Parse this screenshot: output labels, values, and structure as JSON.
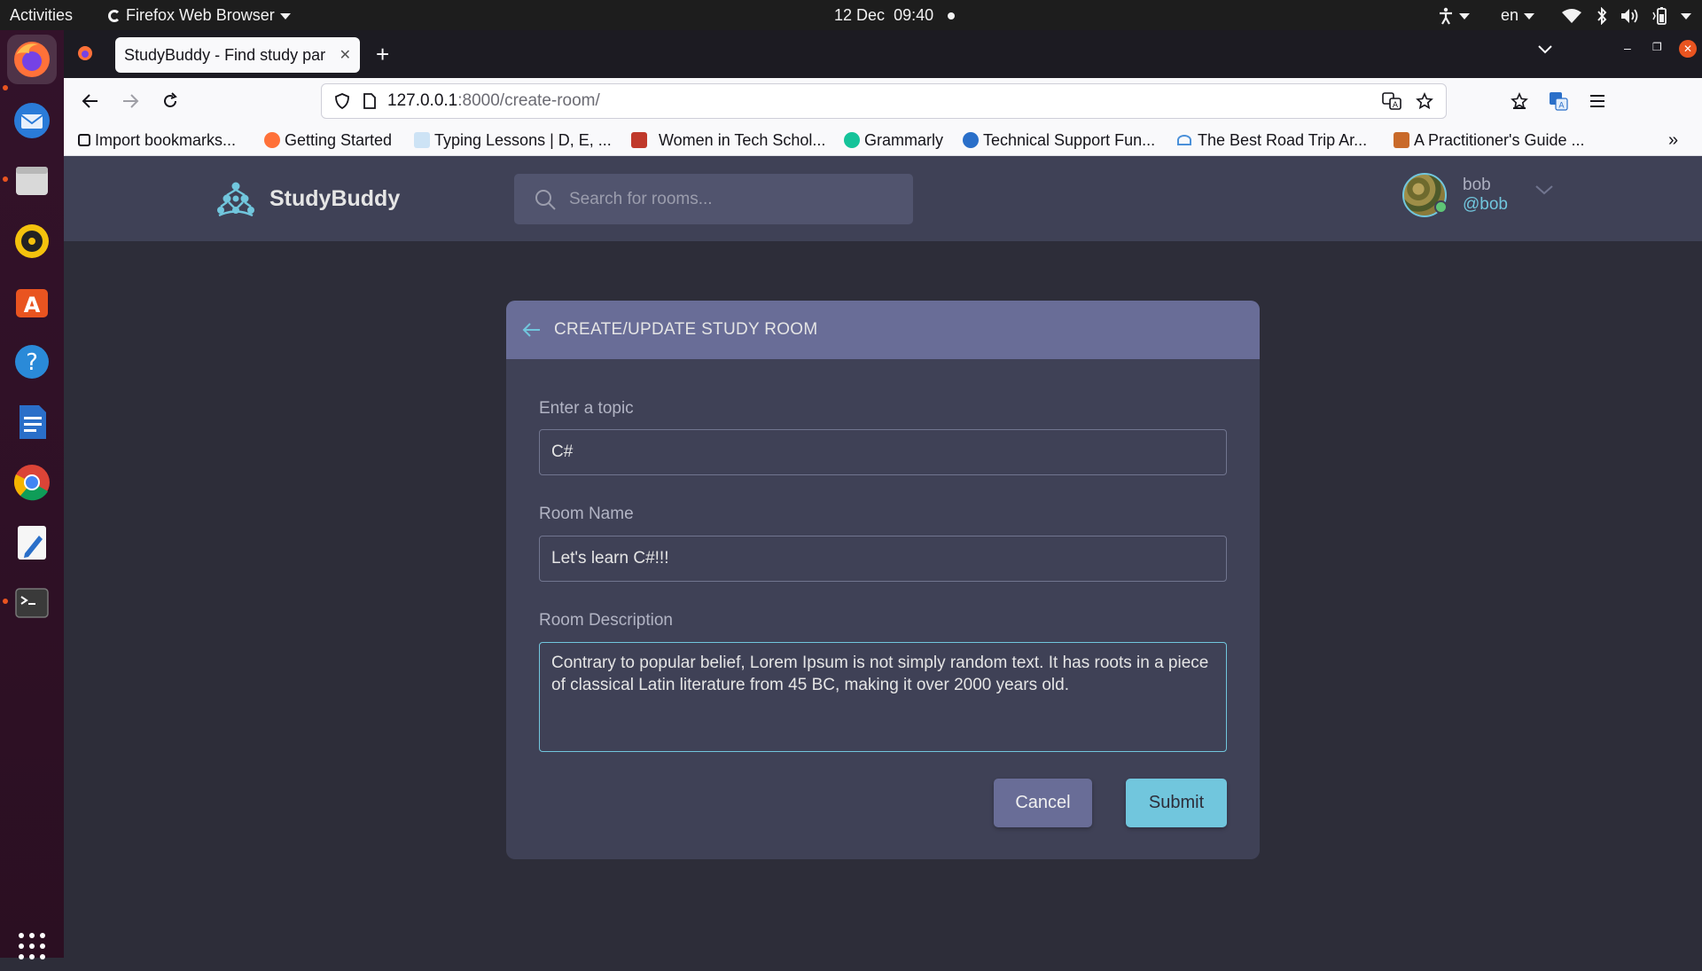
{
  "topbar": {
    "activities": "Activities",
    "app_name": "Firefox Web Browser",
    "date": "12 Dec",
    "time": "09:40",
    "language": "en"
  },
  "dock": {
    "apps": [
      "firefox-icon",
      "thunderbird-icon",
      "files-icon",
      "rhythmbox-icon",
      "software-icon",
      "help-icon",
      "writer-icon",
      "chrome-icon",
      "text-editor-icon",
      "terminal-icon"
    ]
  },
  "browser": {
    "tab_title": "StudyBuddy - Find study par",
    "url_host": "127.0.0.1",
    "url_path": ":8000/create-room/",
    "bookmarks": [
      "Import bookmarks...",
      "Getting Started",
      "Typing Lessons | D, E, ...",
      "Women in Tech Schol...",
      "Grammarly",
      "Technical Support Fun...",
      "The Best Road Trip Ar...",
      "A Practitioner's Guide ..."
    ]
  },
  "app": {
    "brand": "StudyBuddy",
    "search_placeholder": "Search for rooms...",
    "user": {
      "name": "bob",
      "handle": "@bob"
    }
  },
  "form": {
    "title": "CREATE/UPDATE STUDY ROOM",
    "topic_label": "Enter a topic",
    "topic_value": "C#",
    "room_name_label": "Room Name",
    "room_name_value": "Let's learn C#!!!",
    "description_label": "Room Description",
    "description_value": "Contrary to popular belief, Lorem Ipsum is not simply random text. It has roots in a piece of classical Latin literature from 45 BC, making it over 2000 years old.",
    "cancel_label": "Cancel",
    "submit_label": "Submit"
  },
  "colors": {
    "accent": "#71c6dd",
    "header_bg": "#3f4156",
    "card_header": "#696d97",
    "page_bg": "#2d2d39"
  }
}
